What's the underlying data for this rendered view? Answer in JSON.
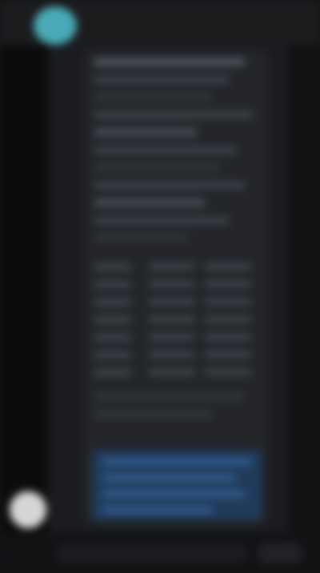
{
  "window": {
    "title": ""
  },
  "content": {
    "lines": [
      {
        "text": ""
      },
      {
        "text": ""
      },
      {
        "text": ""
      },
      {
        "text": ""
      },
      {
        "text": ""
      },
      {
        "text": ""
      },
      {
        "text": ""
      },
      {
        "text": ""
      },
      {
        "text": ""
      },
      {
        "text": ""
      },
      {
        "text": ""
      },
      {
        "text": ""
      },
      {
        "text": ""
      },
      {
        "text": ""
      },
      {
        "text": ""
      },
      {
        "text": ""
      },
      {
        "text": ""
      },
      {
        "text": ""
      },
      {
        "text": ""
      },
      {
        "text": ""
      }
    ],
    "highlighted_lines": [
      {
        "text": ""
      },
      {
        "text": ""
      },
      {
        "text": ""
      },
      {
        "text": ""
      }
    ]
  },
  "colors": {
    "background": "#141517",
    "panel": "#1a1c1f",
    "card": "#232529",
    "accent_teal": "#49a9b4",
    "accent_blue": "#203a5a"
  },
  "icons": {
    "top_avatar": "user-avatar-icon",
    "bottom_avatar": "user-avatar-icon"
  }
}
